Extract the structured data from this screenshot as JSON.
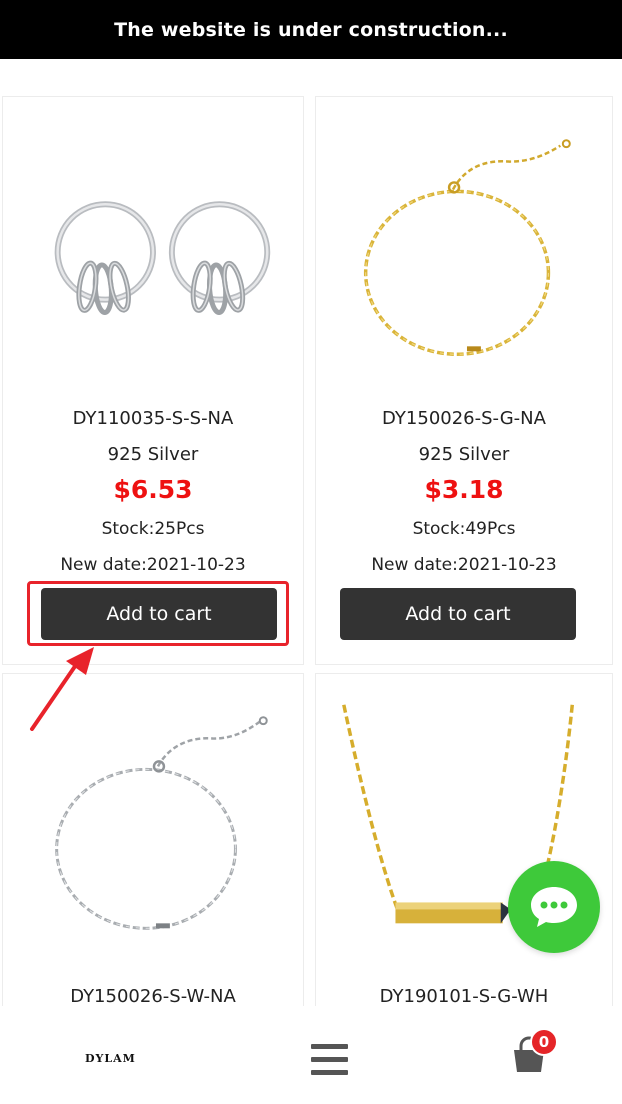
{
  "banner": {
    "text": "The website is under construction..."
  },
  "products": [
    {
      "sku": "DY110035-S-S-NA",
      "material": "925 Silver",
      "price": "$6.53",
      "stock": "Stock:25Pcs",
      "date": "New date:2021-10-23",
      "button": "Add to cart",
      "image": "silver-hoop-earrings"
    },
    {
      "sku": "DY150026-S-G-NA",
      "material": "925 Silver",
      "price": "$3.18",
      "stock": "Stock:49Pcs",
      "date": "New date:2021-10-23",
      "button": "Add to cart",
      "image": "gold-chain-bracelet"
    },
    {
      "sku": "DY150026-S-W-NA",
      "image": "silver-chain-bracelet"
    },
    {
      "sku": "DY190101-S-G-WH",
      "image": "gold-bar-necklace"
    }
  ],
  "bottom_nav": {
    "logo": "DYLAM",
    "cart_count": "0"
  },
  "colors": {
    "banner_bg": "#000000",
    "price": "#ee1111",
    "button_bg": "#333333",
    "highlight": "#e8232b",
    "chat": "#3ec93a",
    "badge": "#e52528"
  }
}
